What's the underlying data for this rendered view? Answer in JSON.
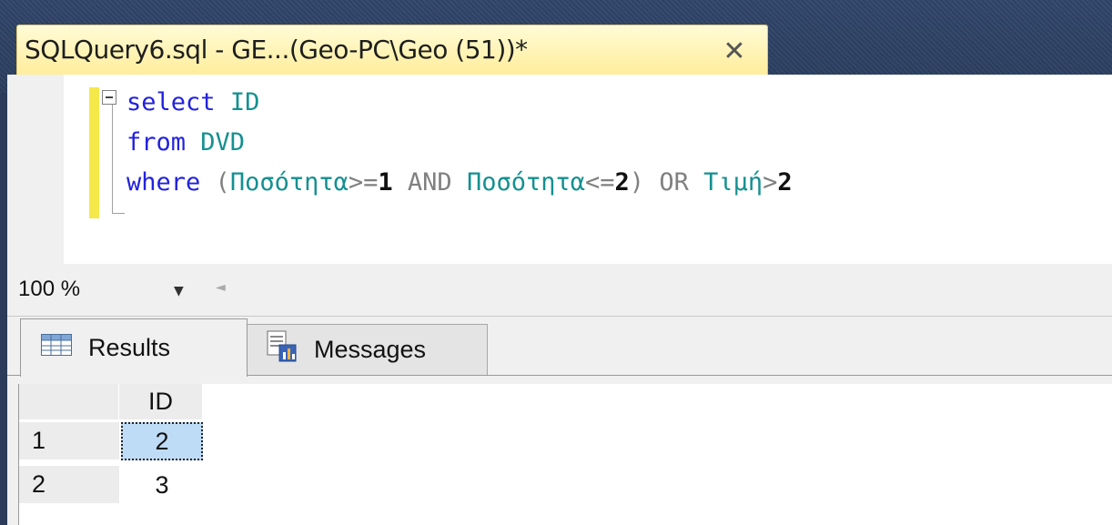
{
  "document_tab": {
    "title": "SQLQuery6.sql - GE...(Geo-PC\\Geo (51))*",
    "close_glyph": "✕"
  },
  "editor": {
    "line1": {
      "keyword": "select",
      "field": "ID"
    },
    "line2": {
      "keyword": "from",
      "table": "DVD"
    },
    "line3": {
      "keyword": "where",
      "open_paren": "(",
      "col1": "Ποσότητα",
      "op1": ">=",
      "val1": "1",
      "and": "AND",
      "col2": "Ποσότητα",
      "op2": "<=",
      "val2": "2",
      "close_paren": ")",
      "or": "OR",
      "col3": "Τιμή",
      "op3": ">",
      "val3": "2"
    }
  },
  "zoom": {
    "value": "100 %"
  },
  "results_tabs": {
    "results_label": "Results",
    "messages_label": "Messages"
  },
  "grid": {
    "columns": [
      "ID"
    ],
    "rows": [
      {
        "row_number": "1",
        "ID": "2"
      },
      {
        "row_number": "2",
        "ID": "3"
      }
    ]
  },
  "colors": {
    "keyword": "#2222dd",
    "identifier": "#159090",
    "tab_active": "#fff0a6",
    "selected_cell": "#bfdcf7"
  }
}
